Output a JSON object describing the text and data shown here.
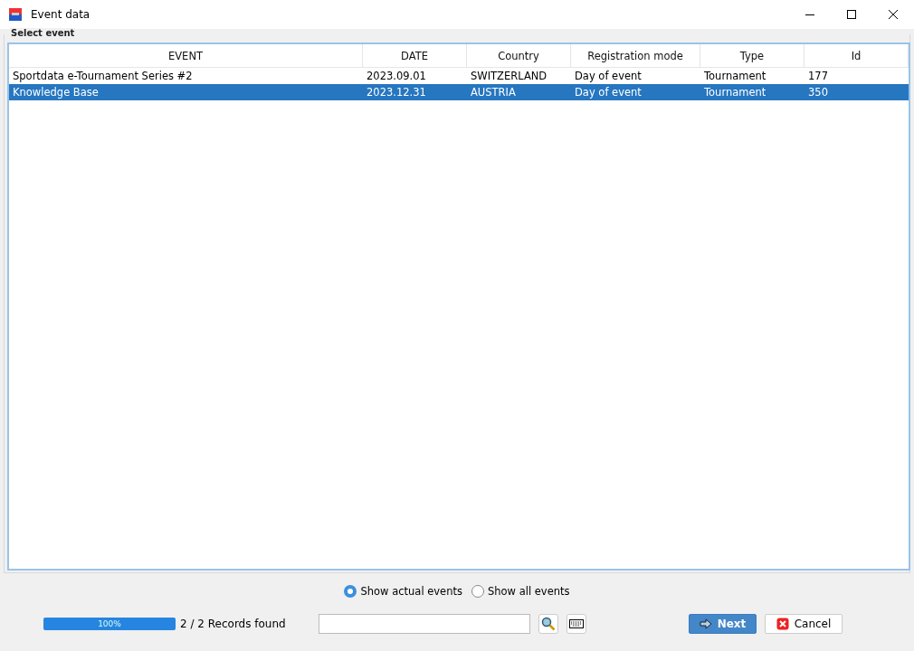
{
  "window": {
    "title": "Event data"
  },
  "group": {
    "title": "Select event"
  },
  "table": {
    "columns": [
      "EVENT",
      "DATE",
      "Country",
      "Registration mode",
      "Type",
      "Id"
    ],
    "rows": [
      {
        "selected": false,
        "cells": [
          "Sportdata e-Tournament Series #2",
          "2023.09.01",
          "SWITZERLAND",
          "Day of event",
          "Tournament",
          "177"
        ]
      },
      {
        "selected": true,
        "cells": [
          "Knowledge Base",
          "2023.12.31",
          "AUSTRIA",
          "Day of event",
          "Tournament",
          "350"
        ]
      }
    ]
  },
  "filter": [
    {
      "label": "Show actual events",
      "selected": true
    },
    {
      "label": "Show all events",
      "selected": false
    }
  ],
  "progress": {
    "level": 1,
    "text": "100%"
  },
  "records": "2 / 2 Records found",
  "buttons": [
    {
      "kind": "next",
      "label": "Next"
    },
    {
      "kind": "cancel",
      "label": "Cancel"
    }
  ]
}
